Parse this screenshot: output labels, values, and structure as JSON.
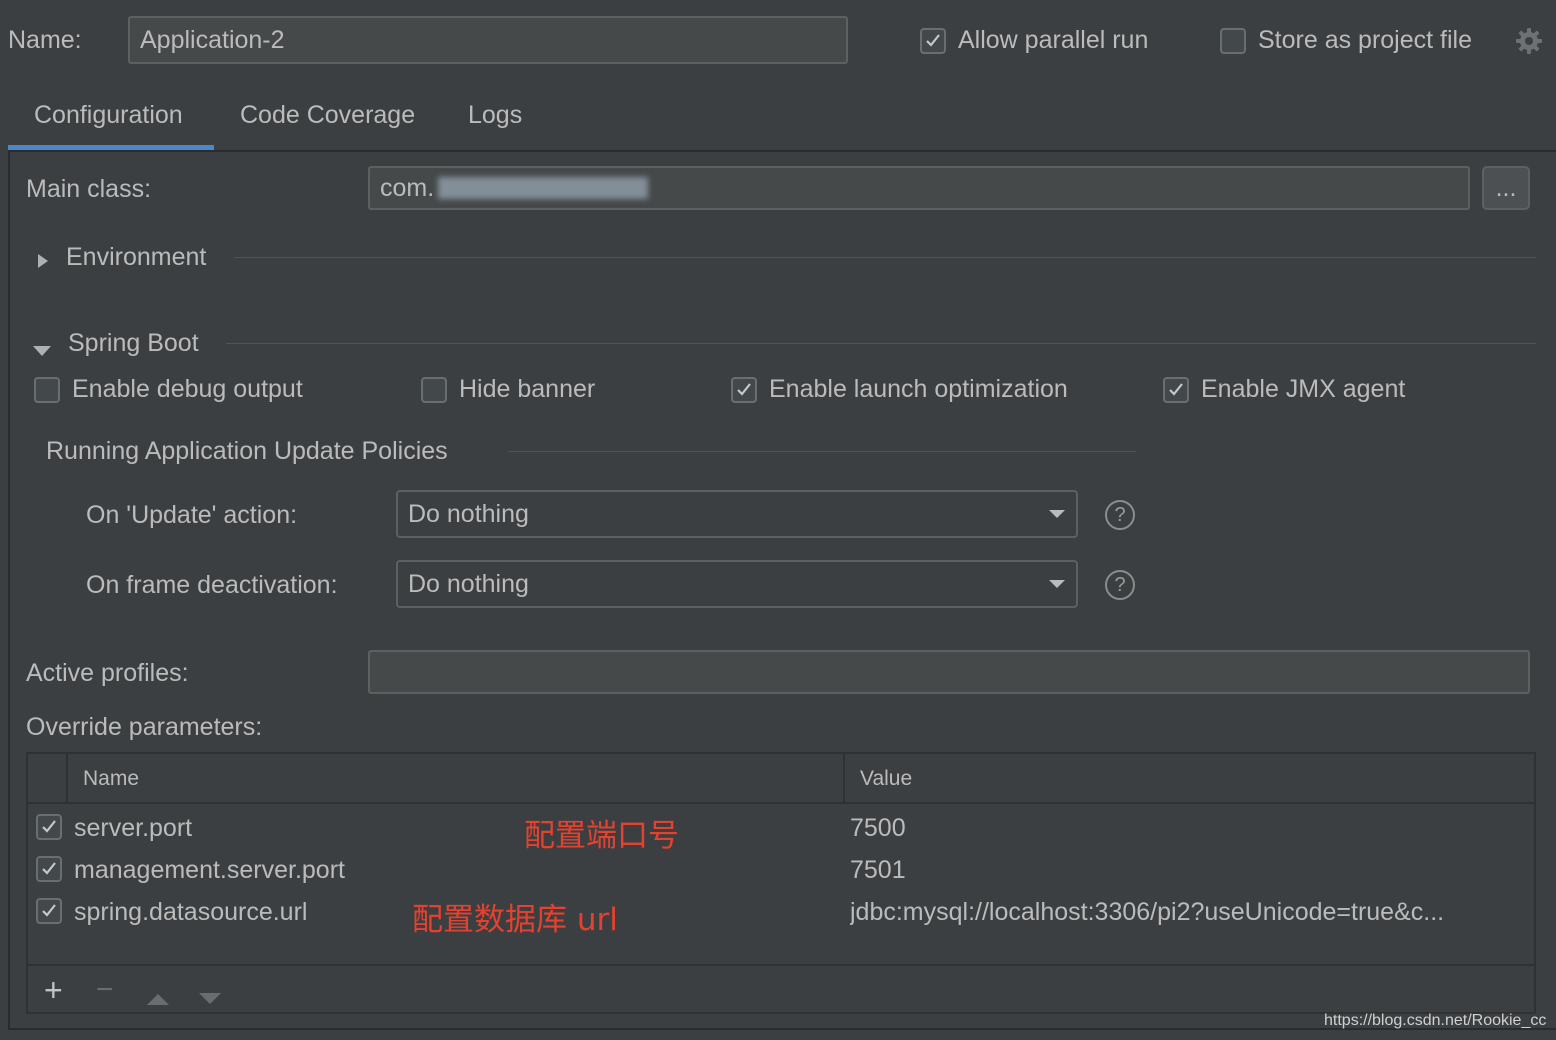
{
  "header": {
    "name_label": "Name:",
    "name_value": "Application-2",
    "allow_parallel_label": "Allow parallel run",
    "allow_parallel_checked": true,
    "store_project_label": "Store as project file",
    "store_project_checked": false
  },
  "tabs": [
    {
      "label": "Configuration",
      "active": true
    },
    {
      "label": "Code Coverage",
      "active": false
    },
    {
      "label": "Logs",
      "active": false
    }
  ],
  "main_class": {
    "label": "Main class:",
    "value": "com.",
    "browse_label": "..."
  },
  "environment": {
    "label": "Environment",
    "expanded": false
  },
  "spring_boot": {
    "label": "Spring Boot",
    "expanded": true,
    "options": {
      "debug_label": "Enable debug output",
      "debug_checked": false,
      "banner_label": "Hide banner",
      "banner_checked": false,
      "launch_label": "Enable launch optimization",
      "launch_checked": true,
      "jmx_label": "Enable JMX agent",
      "jmx_checked": true
    },
    "policies": {
      "title": "Running Application Update Policies",
      "update_label": "On 'Update' action:",
      "update_value": "Do nothing",
      "frame_label": "On frame deactivation:",
      "frame_value": "Do nothing"
    }
  },
  "active_profiles": {
    "label": "Active profiles:",
    "value": ""
  },
  "override": {
    "label": "Override parameters:",
    "columns": {
      "name": "Name",
      "value": "Value"
    },
    "rows": [
      {
        "checked": true,
        "name": "server.port",
        "value": "7500"
      },
      {
        "checked": true,
        "name": "management.server.port",
        "value": "7501"
      },
      {
        "checked": true,
        "name": "spring.datasource.url",
        "value": "jdbc:mysql://localhost:3306/pi2?useUnicode=true&c..."
      }
    ],
    "annotations": {
      "port": "配置端口号",
      "datasource": "配置数据库 url"
    },
    "toolbar": {
      "add": "+",
      "remove": "−"
    }
  },
  "watermark": "https://blog.csdn.net/Rookie_cc",
  "colors": {
    "accent": "#4a88c7",
    "annotation": "#e5412f",
    "background": "#3c3f41"
  }
}
